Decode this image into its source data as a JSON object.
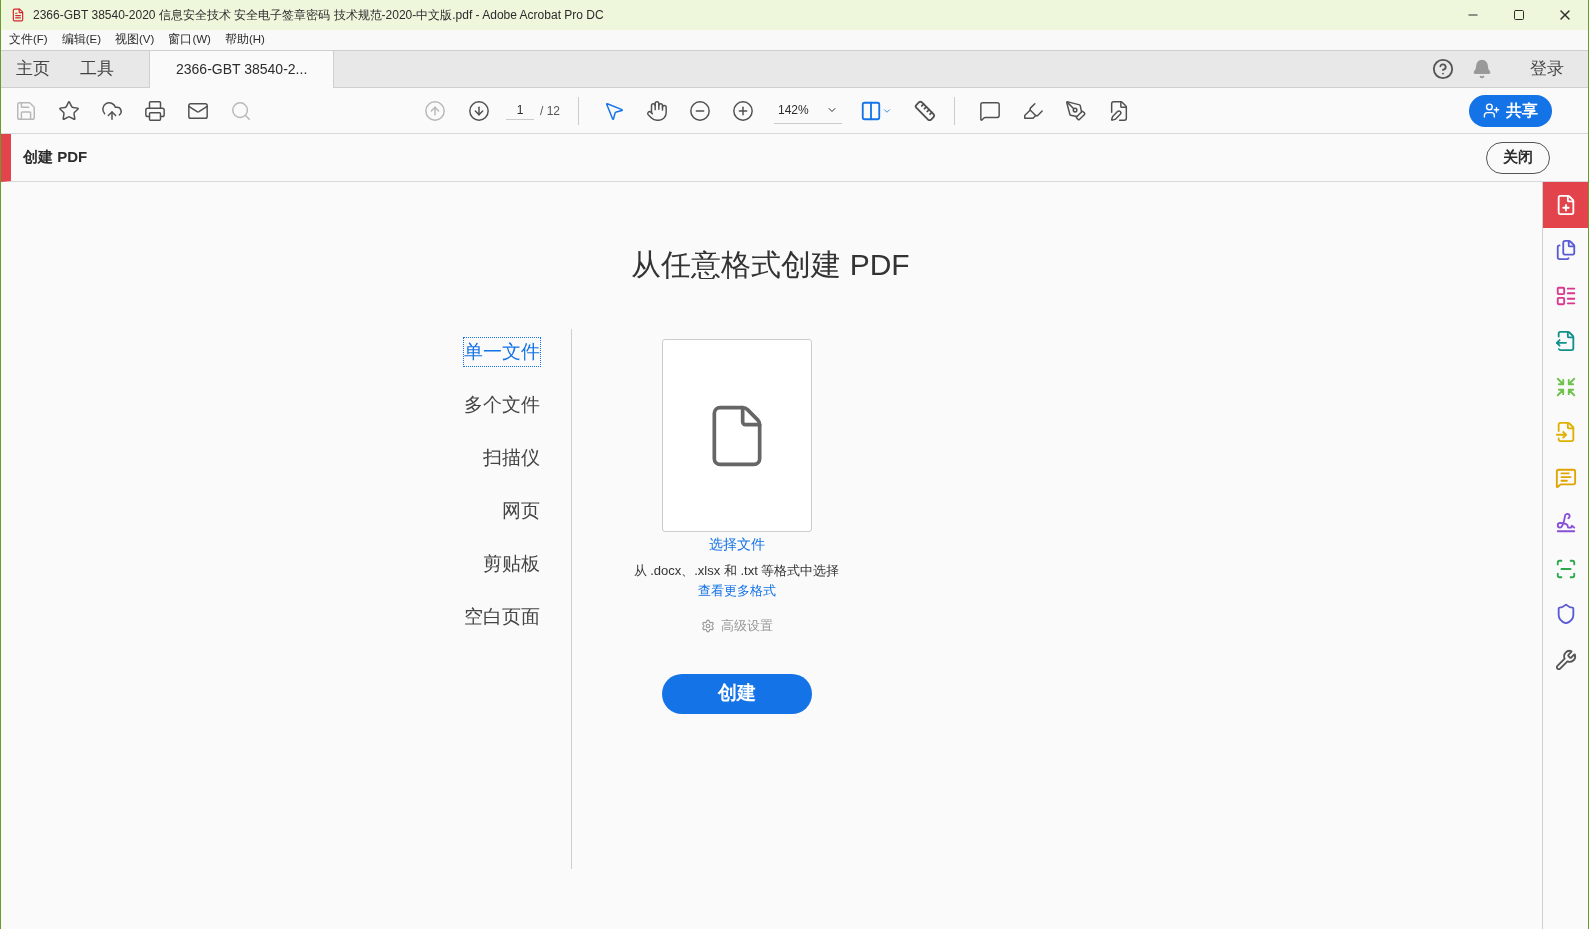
{
  "window": {
    "title": "2366-GBT 38540-2020 信息安全技术 安全电子签章密码 技术规范-2020-中文版.pdf - Adobe Acrobat Pro DC"
  },
  "menu": [
    "文件(F)",
    "编辑(E)",
    "视图(V)",
    "窗口(W)",
    "帮助(H)"
  ],
  "tabs": [
    {
      "label": "主页",
      "selected": false
    },
    {
      "label": "工具",
      "selected": false
    },
    {
      "label": "2366-GBT 38540-2...",
      "selected": true
    }
  ],
  "sign_in": "登录",
  "toolbar": {
    "left": [
      {
        "kind": "save",
        "disabled": true
      },
      {
        "kind": "star",
        "disabled": false
      },
      {
        "kind": "upload",
        "disabled": false
      },
      {
        "kind": "print",
        "disabled": false
      },
      {
        "kind": "mail",
        "disabled": false
      },
      {
        "kind": "search",
        "disabled": true
      }
    ],
    "nav": [
      {
        "kind": "up",
        "disabled": true
      },
      {
        "kind": "down",
        "disabled": false
      }
    ],
    "page": "1",
    "page_total": "/ 12",
    "view": [
      {
        "kind": "pointer",
        "selected": true
      },
      {
        "kind": "hand",
        "selected": false
      },
      {
        "kind": "zoom-out",
        "selected": false
      },
      {
        "kind": "zoom-in",
        "selected": false
      }
    ],
    "zoom": "142%",
    "annotate": [
      {
        "kind": "comment"
      },
      {
        "kind": "highlight"
      },
      {
        "kind": "sign"
      },
      {
        "kind": "edit"
      }
    ],
    "share": "共享"
  },
  "panel": {
    "title": "创建 PDF",
    "close": "关闭"
  },
  "heading": "从任意格式创建 PDF",
  "sources": [
    {
      "label": "单一文件",
      "selected": true
    },
    {
      "label": "多个文件",
      "selected": false
    },
    {
      "label": "扫描仪",
      "selected": false
    },
    {
      "label": "网页",
      "selected": false
    },
    {
      "label": "剪贴板",
      "selected": false
    },
    {
      "label": "空白页面",
      "selected": false
    }
  ],
  "select_file": "选择文件",
  "formats_hint": "从 .docx、.xlsx 和 .txt 等格式中选择",
  "more_formats": "查看更多格式",
  "advanced": "高级设置",
  "create": "创建",
  "tools_rail": [
    {
      "kind": "create",
      "color": "#ffffff",
      "selected": true
    },
    {
      "kind": "combine",
      "color": "#5b5bd6",
      "selected": false
    },
    {
      "kind": "organize",
      "color": "#d9378c",
      "selected": false
    },
    {
      "kind": "export",
      "color": "#12918c",
      "selected": false
    },
    {
      "kind": "compress",
      "color": "#6cc24a",
      "selected": false
    },
    {
      "kind": "forms",
      "color": "#e0b000",
      "selected": false
    },
    {
      "kind": "comment",
      "color": "#e0a400",
      "selected": false
    },
    {
      "kind": "fill-sign",
      "color": "#8a4fd8",
      "selected": false
    },
    {
      "kind": "scan",
      "color": "#2aa84a",
      "selected": false
    },
    {
      "kind": "protect",
      "color": "#5a5ad6",
      "selected": false
    },
    {
      "kind": "more",
      "color": "#555555",
      "selected": false
    }
  ]
}
